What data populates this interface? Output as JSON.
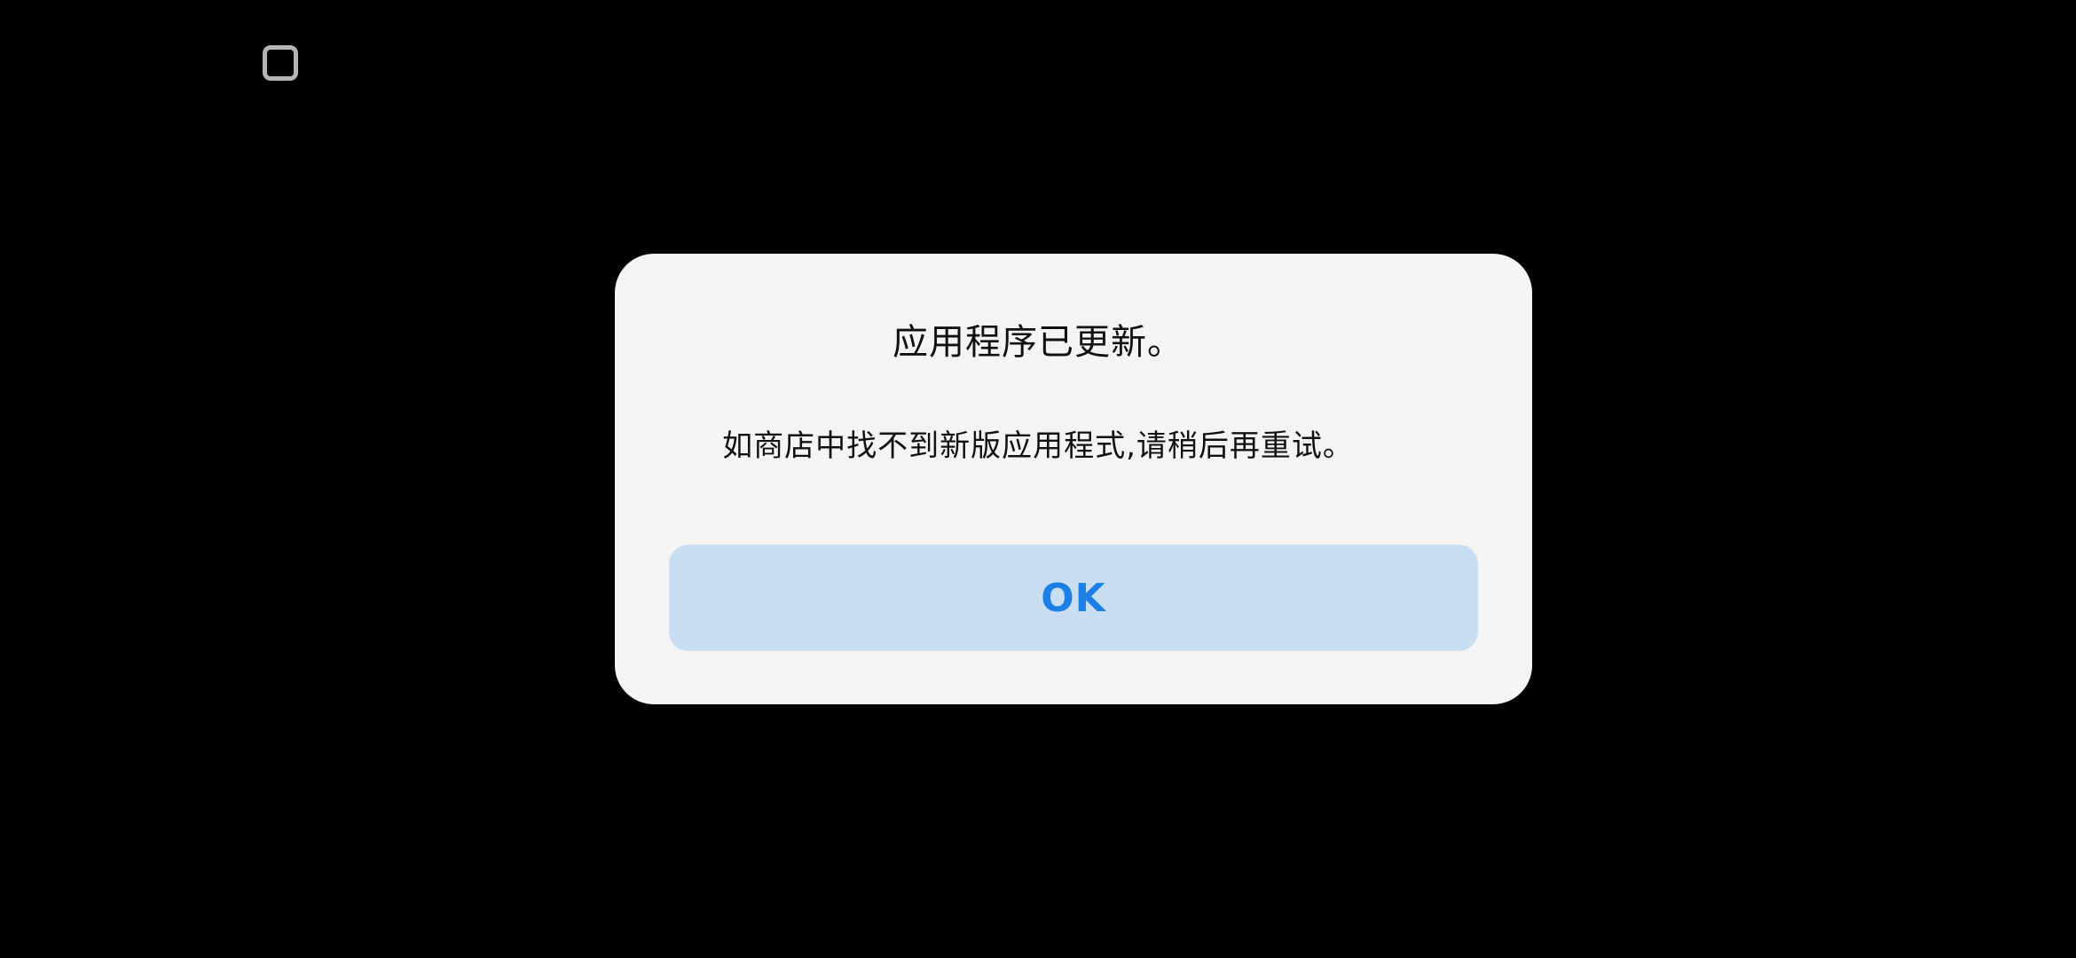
{
  "status_bar": {
    "icon": "square-outline-icon"
  },
  "dialog": {
    "title": "应用程序已更新。",
    "message": "如商店中找不到新版应用程式,请稍后再重试。",
    "ok_label": "OK"
  },
  "colors": {
    "background": "#000000",
    "dialog_background": "#f4f4f4",
    "button_background": "#cadef3",
    "button_text": "#1b7fe6"
  }
}
